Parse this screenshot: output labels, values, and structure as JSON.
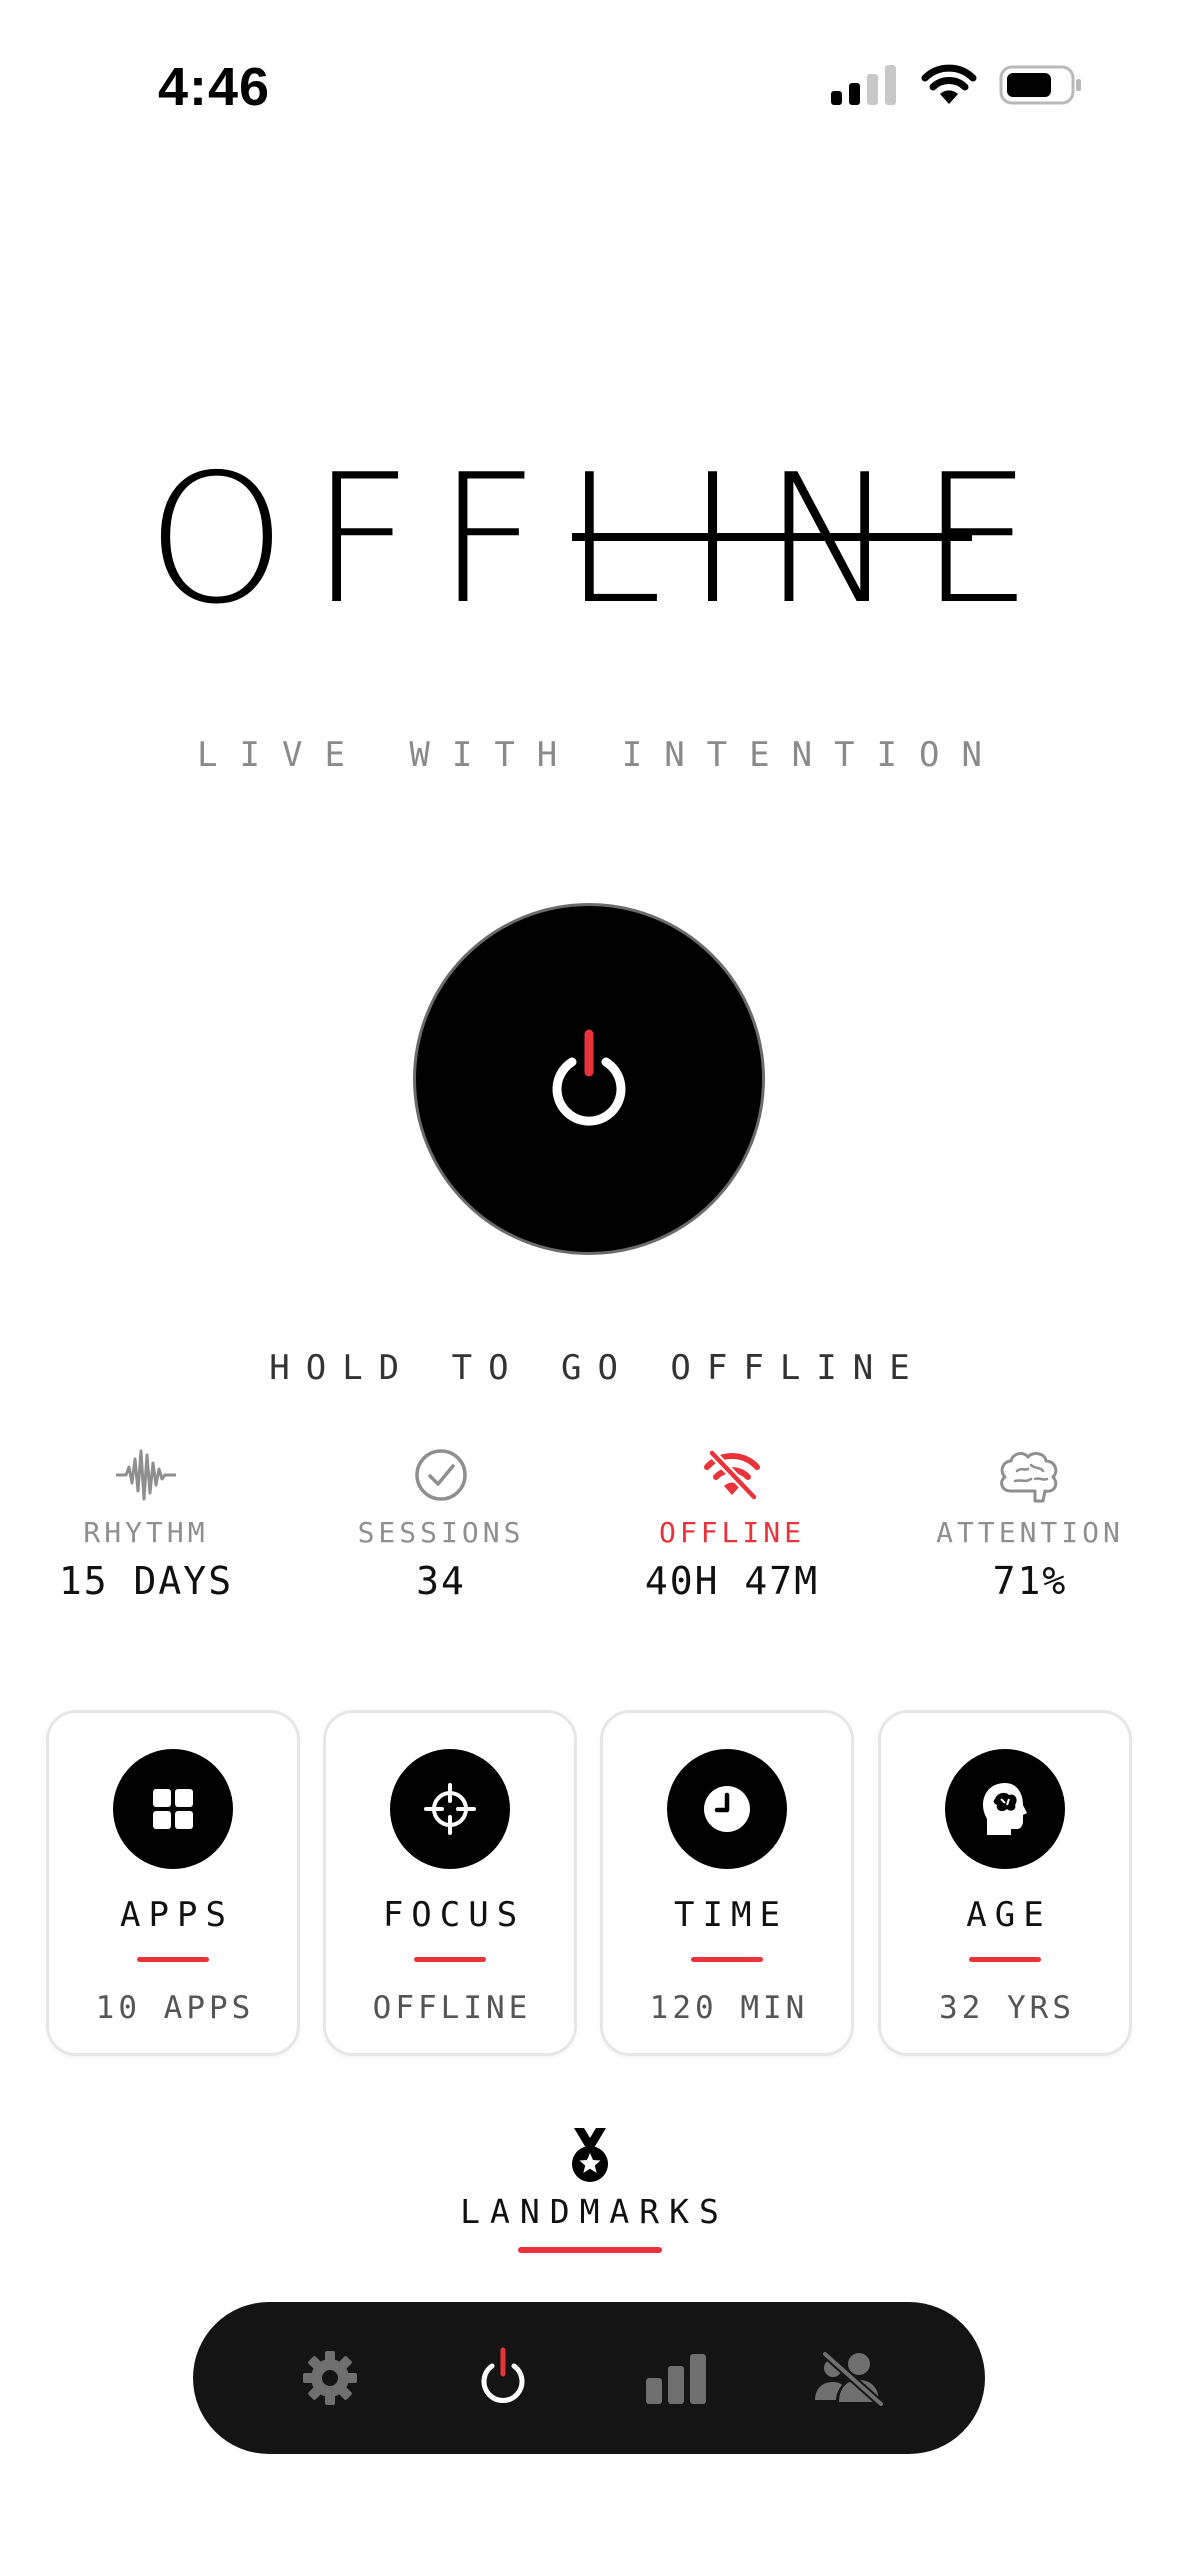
{
  "status_bar": {
    "time": "4:46"
  },
  "hero": {
    "logo": "OFFLINE",
    "tagline": "LIVE WITH INTENTION"
  },
  "power": {
    "hold_label": "HOLD TO GO OFFLINE",
    "accent_color": "#e8333a"
  },
  "stats": [
    {
      "icon": "waveform-icon",
      "label": "RHYTHM",
      "value": "15 DAYS"
    },
    {
      "icon": "check-circle-icon",
      "label": "SESSIONS",
      "value": "34"
    },
    {
      "icon": "wifi-off-icon",
      "label": "OFFLINE",
      "value": "40H 47M",
      "color": "#e8333a"
    },
    {
      "icon": "brain-icon",
      "label": "ATTENTION",
      "value": "71%"
    }
  ],
  "cards": [
    {
      "icon": "apps-grid-icon",
      "title": "APPS",
      "subtitle": "10 APPS"
    },
    {
      "icon": "crosshair-icon",
      "title": "FOCUS",
      "subtitle": "OFFLINE"
    },
    {
      "icon": "clock-icon",
      "title": "TIME",
      "subtitle": "120 MIN"
    },
    {
      "icon": "head-brain-icon",
      "title": "AGE",
      "subtitle": "32 YRS"
    }
  ],
  "landmarks": {
    "icon": "medal-icon",
    "label": "LANDMARKS"
  },
  "nav": {
    "items": [
      {
        "icon": "gear-icon",
        "active": false
      },
      {
        "icon": "power-icon",
        "active": true
      },
      {
        "icon": "bar-chart-icon",
        "active": false
      },
      {
        "icon": "people-off-icon",
        "active": false
      }
    ]
  }
}
